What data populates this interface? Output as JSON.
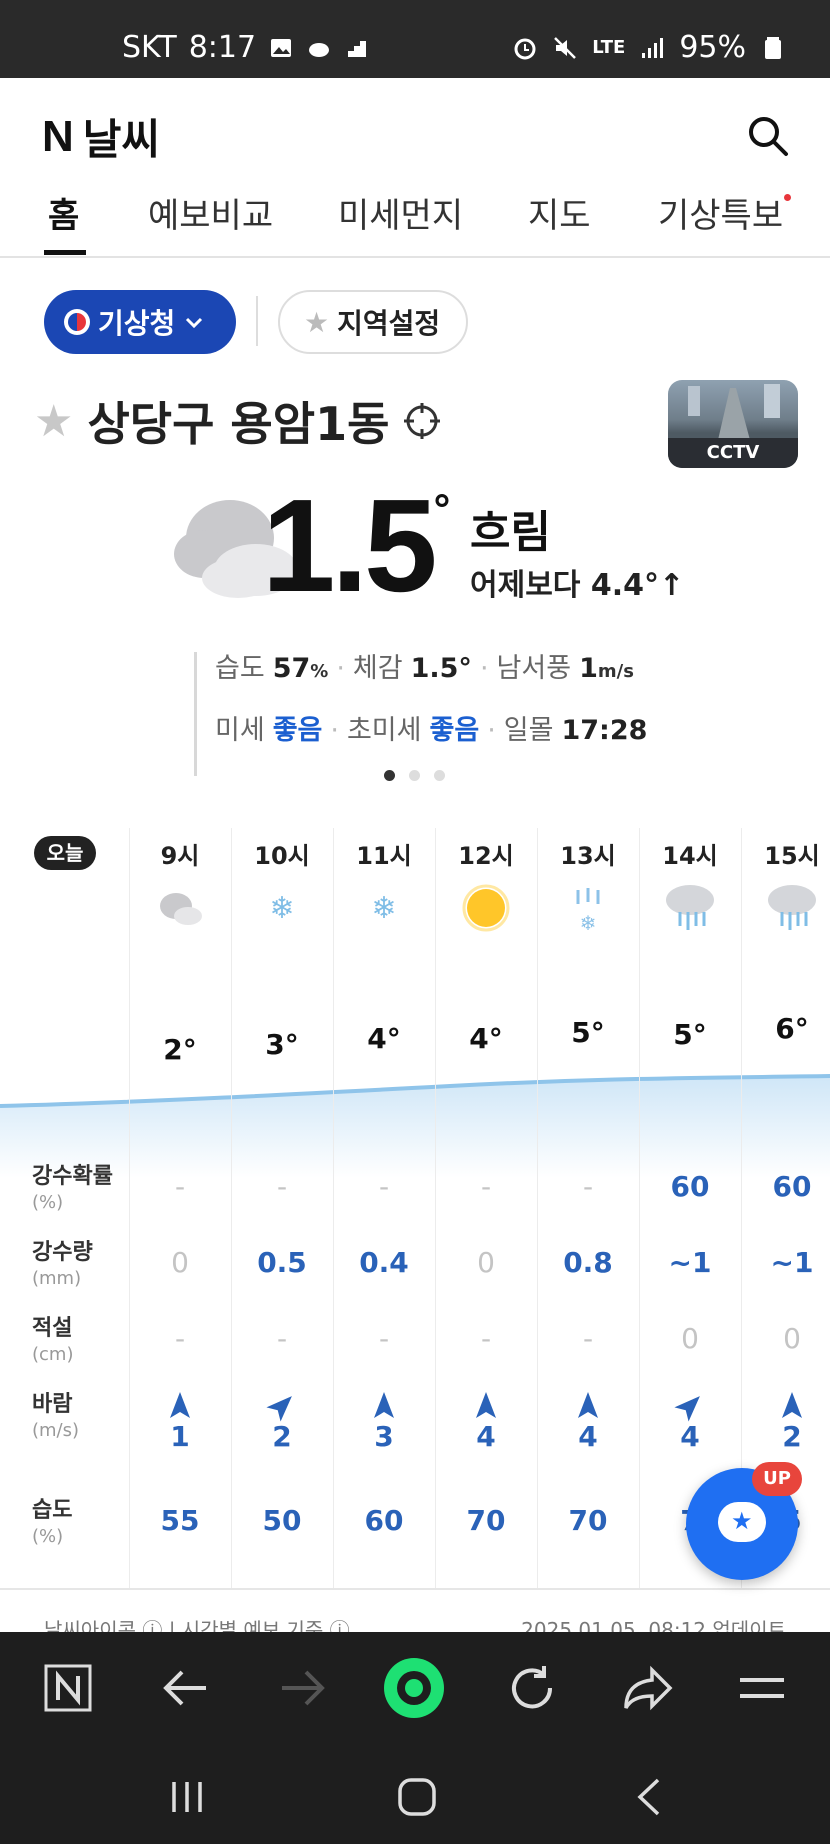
{
  "status": {
    "carrier": "SKT",
    "time": "8:17",
    "network": "LTE",
    "battery": "95%"
  },
  "app": {
    "logo_letter": "N",
    "title": "날씨"
  },
  "tabs": [
    {
      "label": "홈",
      "active": true
    },
    {
      "label": "예보비교"
    },
    {
      "label": "미세먼지"
    },
    {
      "label": "지도"
    },
    {
      "label": "기상특보",
      "has_dot": true
    }
  ],
  "source": {
    "provider": "기상청",
    "region_setting": "지역설정"
  },
  "location": {
    "name": "상당구 용암1동",
    "cctv_label": "CCTV"
  },
  "current": {
    "temp": "1.5",
    "degree": "°",
    "condition": "흐림",
    "vs_yesterday": "어제보다 4.4°↑"
  },
  "details": {
    "humidity_label": "습도",
    "humidity_value": "57",
    "humidity_unit": "%",
    "feels_label": "체감",
    "feels_value": "1.5°",
    "wind_label": "남서풍",
    "wind_value": "1",
    "wind_unit": "m/s",
    "pm10_label": "미세",
    "pm10_value": "좋음",
    "pm25_label": "초미세",
    "pm25_value": "좋음",
    "sunset_label": "일몰",
    "sunset_value": "17:28"
  },
  "hourly": {
    "today_label": "오늘",
    "hours": [
      "9시",
      "10시",
      "11시",
      "12시",
      "13시",
      "14시",
      "15시"
    ],
    "icons": [
      "cloudy-icon",
      "snow-icon",
      "snow-icon",
      "sunny-icon",
      "sleet-icon",
      "rain-icon",
      "rain-icon"
    ],
    "temps": [
      "2°",
      "3°",
      "4°",
      "4°",
      "5°",
      "5°",
      "6°"
    ],
    "rows": [
      {
        "label": "강수확률",
        "unit": "(%)",
        "values": [
          "-",
          "-",
          "-",
          "-",
          "-",
          "60",
          "60"
        ]
      },
      {
        "label": "강수량",
        "unit": "(mm)",
        "values": [
          "0",
          "0.5",
          "0.4",
          "0",
          "0.8",
          "~1",
          "~1"
        ]
      },
      {
        "label": "적설",
        "unit": "(cm)",
        "values": [
          "-",
          "-",
          "-",
          "-",
          "-",
          "0",
          "0"
        ]
      },
      {
        "label": "바람",
        "unit": "(m/s)",
        "values": [
          "1",
          "2",
          "3",
          "4",
          "4",
          "4",
          "2"
        ]
      },
      {
        "label": "습도",
        "unit": "(%)",
        "values": [
          "55",
          "50",
          "60",
          "70",
          "70",
          "7",
          "5"
        ]
      }
    ]
  },
  "footer": {
    "left": "날씨아이콘 ⓘ | 시간별 예보 기준 ⓘ",
    "right": "2025.01.05. 08:12 업데이트"
  },
  "fab": {
    "badge": "UP"
  },
  "colors": {
    "brand_blue": "#1b47b4",
    "accent_blue": "#2a62b8",
    "fab_blue": "#1f6ff2",
    "badge_red": "#e8453c"
  }
}
